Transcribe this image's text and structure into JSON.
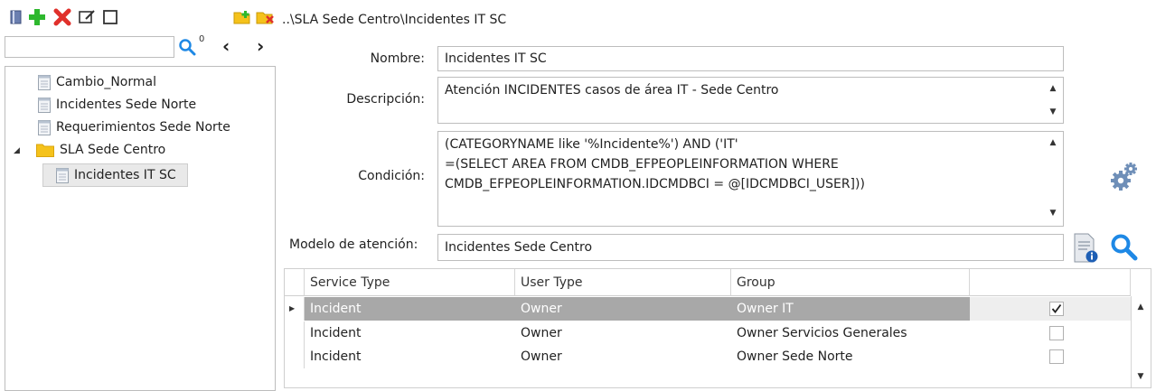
{
  "toolbar": {
    "icons": [
      "notebook-icon",
      "add-icon",
      "delete-icon",
      "edit-icon",
      "square-icon"
    ],
    "folder_icons": [
      "new-folder-icon",
      "delete-folder-icon"
    ]
  },
  "search": {
    "value": "",
    "count": "0"
  },
  "breadcrumb": "..\\SLA Sede Centro\\Incidentes IT SC",
  "tree": {
    "items": [
      {
        "label": "Cambio_Normal"
      },
      {
        "label": "Incidentes Sede Norte"
      },
      {
        "label": "Requerimientos Sede Norte"
      },
      {
        "label": "SLA Sede Centro"
      },
      {
        "label": "Incidentes IT SC"
      }
    ]
  },
  "form": {
    "nombre_label": "Nombre:",
    "nombre_value": "Incidentes IT SC",
    "descripcion_label": "Descripción:",
    "descripcion_value": "Atención INCIDENTES casos de área IT - Sede Centro",
    "condicion_label": "Condición:",
    "condicion_line1": "(CATEGORYNAME like '%Incidente%') AND ('IT'",
    "condicion_line2": "=(SELECT AREA FROM CMDB_EFPEOPLEINFORMATION WHERE",
    "condicion_line3": "CMDB_EFPEOPLEINFORMATION.IDCMDBCI =  @[IDCMDBCI_USER]))",
    "modelo_label": "Modelo de atención:",
    "modelo_value": "Incidentes Sede Centro"
  },
  "grid": {
    "headers": [
      "Service Type",
      "User Type",
      "Group",
      ""
    ],
    "rows": [
      {
        "service": "Incident",
        "user": "Owner",
        "group": "Owner IT",
        "checked": true,
        "selected": true
      },
      {
        "service": "Incident",
        "user": "Owner",
        "group": "Owner Servicios Generales",
        "checked": false,
        "selected": false
      },
      {
        "service": "Incident",
        "user": "Owner",
        "group": "Owner Sede Norte",
        "checked": false,
        "selected": false
      }
    ]
  },
  "colors": {
    "accent_blue": "#1e88e5",
    "add_green": "#2eb82e",
    "delete_red": "#e0302b",
    "folder_yellow": "#f5c21b",
    "selected_row": "#a8a8a8"
  }
}
